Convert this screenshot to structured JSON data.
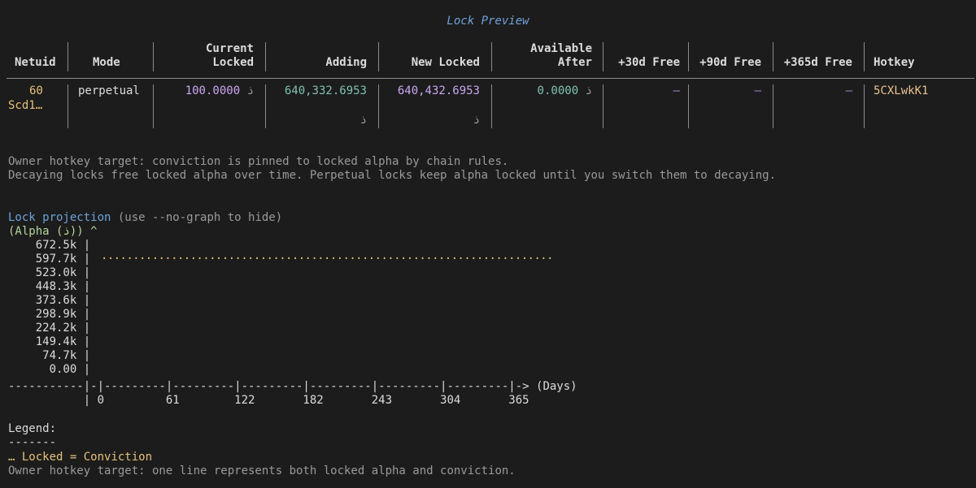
{
  "title": "Lock Preview",
  "table": {
    "headers": [
      {
        "l1": "",
        "l2": "Netuid"
      },
      {
        "l1": "",
        "l2": "Mode"
      },
      {
        "l1": "Current",
        "l2": "Locked"
      },
      {
        "l1": "",
        "l2": "Adding"
      },
      {
        "l1": "",
        "l2": "New Locked"
      },
      {
        "l1": "Available",
        "l2": "After"
      },
      {
        "l1": "",
        "l2": "+30d Free"
      },
      {
        "l1": "",
        "l2": "+90d Free"
      },
      {
        "l1": "",
        "l2": "+365d Free"
      },
      {
        "l1": "",
        "l2": "Hotkey"
      }
    ],
    "row": {
      "netuid": "60",
      "netuid_wrap": "Scd1…",
      "mode": "perpetual",
      "current_locked": "100.0000",
      "current_unit": "ذ",
      "adding": "640,332.6953",
      "adding_unit": "ذ",
      "new_locked": "640,432.6953",
      "new_unit": "ذ",
      "available_after": "0.0000",
      "available_unit": "ذ",
      "free_30d": "—",
      "free_90d": "—",
      "free_365d": "—",
      "hotkey": "5CXLwkK1"
    }
  },
  "notes": {
    "line1": "Owner hotkey target: conviction is pinned to locked alpha by chain rules.",
    "line2": "Decaying locks free locked alpha over time. Perpetual locks keep alpha locked until you switch them to decaying."
  },
  "projection": {
    "heading": "Lock projection",
    "hint": " (use --no-graph to hide)",
    "y_axis_label": "(Alpha (ذ)) ^",
    "y_ticks": [
      "672.5k",
      "597.7k",
      "523.0k",
      "448.3k",
      "373.6k",
      "298.9k",
      "224.2k",
      "149.4k",
      "74.7k",
      "0.00"
    ],
    "axis_line": "-----------|-|---------|---------|---------|---------|---------|---------|-> (Days)",
    "x_ticks_line": "           | 0         61        122       182       243       304       365",
    "dotted_line": "·······································································"
  },
  "chart_data": {
    "type": "line",
    "title": "Lock projection",
    "xlabel": "(Days)",
    "ylabel": "(Alpha (ذ))",
    "x_ticks": [
      0,
      61,
      122,
      182,
      243,
      304,
      365
    ],
    "y_ticks": [
      672.5,
      597.7,
      523.0,
      448.3,
      373.6,
      298.9,
      224.2,
      149.4,
      74.7,
      0.0
    ],
    "series": [
      {
        "name": "Locked = Conviction",
        "x": [
          0,
          365
        ],
        "values": [
          640432.6953,
          640432.6953
        ]
      }
    ],
    "xlim": [
      0,
      365
    ],
    "ylim": [
      0,
      672500
    ],
    "color": "#e6c27a"
  },
  "legend": {
    "title": "Legend:",
    "rule": "-------",
    "marker": "…",
    "entry": " Locked = Conviction",
    "note": "Owner hotkey target: one line represents both locked alpha and conviction."
  },
  "colors": {
    "background": "#1c1c1c",
    "title": "#6ea2d8",
    "purple": "#c9a6f0",
    "teal": "#7fc2b0",
    "gold": "#e6c27a",
    "green": "#b5d69a"
  }
}
